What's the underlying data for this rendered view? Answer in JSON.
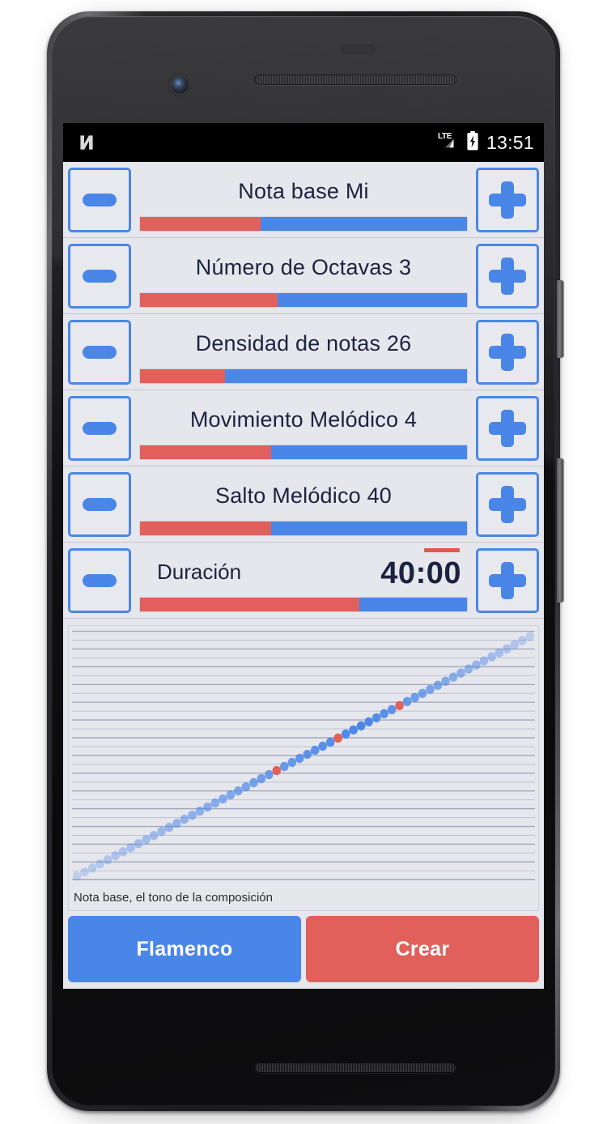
{
  "status_bar": {
    "left_icon": "android-n-icon",
    "network_label": "LTE",
    "signal_icon": "signal-bars-icon",
    "battery_icon": "battery-charging-icon",
    "clock": "13:51"
  },
  "colors": {
    "accent_blue": "#4a86e8",
    "accent_red": "#e2605c",
    "app_background": "#e6e7ec",
    "text_dark": "#1c2340"
  },
  "stepper": {
    "decrement_name": "minus-icon",
    "increment_name": "plus-icon"
  },
  "rows": [
    {
      "id": "nota-base",
      "label": "Nota base Mi",
      "slider_percent": 37
    },
    {
      "id": "numero-de-octavas",
      "label": "Número de Octavas 3",
      "slider_percent": 42
    },
    {
      "id": "densidad-de-notas",
      "label": "Densidad de notas 26",
      "slider_percent": 26
    },
    {
      "id": "movimiento-melodico",
      "label": "Movimiento Melódico 4",
      "slider_percent": 40
    },
    {
      "id": "salto-melodico",
      "label": "Salto Melódico 40",
      "slider_percent": 40
    }
  ],
  "duration_row": {
    "id": "duracion",
    "label": "Duración",
    "value": "40:00",
    "slider_percent": 67,
    "marker_name": "duration-edit-marker"
  },
  "chart_caption": "Nota base, el tono de la composición",
  "footer": {
    "style_button": "Flamenco",
    "create_button": "Crear"
  },
  "chart_data": {
    "type": "scatter",
    "title": "",
    "subtitle": "Nota base, el tono de la composición",
    "xlabel": "",
    "ylabel": "",
    "grid": true,
    "gridlines": 29,
    "legend_position": "none",
    "xlim": [
      0,
      59
    ],
    "ylim": [
      0,
      59
    ],
    "series": [
      {
        "name": "notes",
        "color": "#4a86e8",
        "x": [
          0,
          1,
          2,
          3,
          4,
          5,
          6,
          7,
          8,
          9,
          10,
          11,
          12,
          13,
          14,
          15,
          16,
          17,
          18,
          19,
          20,
          21,
          22,
          23,
          24,
          25,
          26,
          27,
          28,
          29,
          30,
          31,
          32,
          33,
          34,
          35,
          36,
          37,
          38,
          39,
          40,
          41,
          42,
          43,
          44,
          45,
          46,
          47,
          48,
          49,
          50,
          51,
          52,
          53,
          54,
          55,
          56,
          57,
          58,
          59
        ],
        "y": [
          0,
          1,
          2,
          3,
          4,
          5,
          6,
          7,
          8,
          9,
          10,
          11,
          12,
          13,
          14,
          15,
          16,
          17,
          18,
          19,
          20,
          21,
          22,
          23,
          24,
          25,
          26,
          27,
          28,
          29,
          30,
          31,
          32,
          33,
          34,
          35,
          36,
          37,
          38,
          39,
          40,
          41,
          42,
          43,
          44,
          45,
          46,
          47,
          48,
          49,
          50,
          51,
          52,
          53,
          54,
          55,
          56,
          57,
          58,
          59
        ],
        "opacity_ramp": [
          0.28,
          1.0,
          0.28
        ],
        "highlight_indices": [
          26,
          34,
          42
        ],
        "highlight_color": "#e2574c"
      }
    ]
  }
}
